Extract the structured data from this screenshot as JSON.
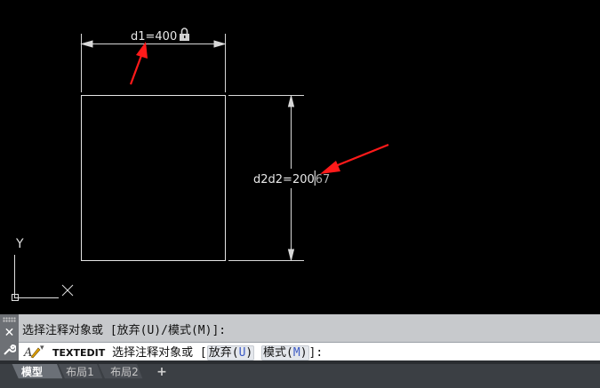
{
  "drawing": {
    "dim_top_label": "d1=400",
    "dim_right_label": "d2d2=200",
    "dim_right_suffix": "67",
    "ucs_y": "Y",
    "ucs_x": "X",
    "lock_icon": "lock-icon",
    "annotation_color": "#ff1a1a"
  },
  "command": {
    "history_line": "选择注释对象或 [放弃(U)/模式(M)]:",
    "command_name": "TEXTEDIT",
    "prompt_text": "选择注释对象或 [",
    "opt1_label": "放弃(",
    "opt1_key": "U",
    "opt1_close": ")",
    "opt2_label": "模式(",
    "opt2_key": "M",
    "opt2_close": ")",
    "prompt_end": "]:",
    "close_icon": "✕",
    "wrench_icon": "🔧"
  },
  "tabs": {
    "model": "模型",
    "layout1": "布局1",
    "layout2": "布局2",
    "add": "+"
  }
}
